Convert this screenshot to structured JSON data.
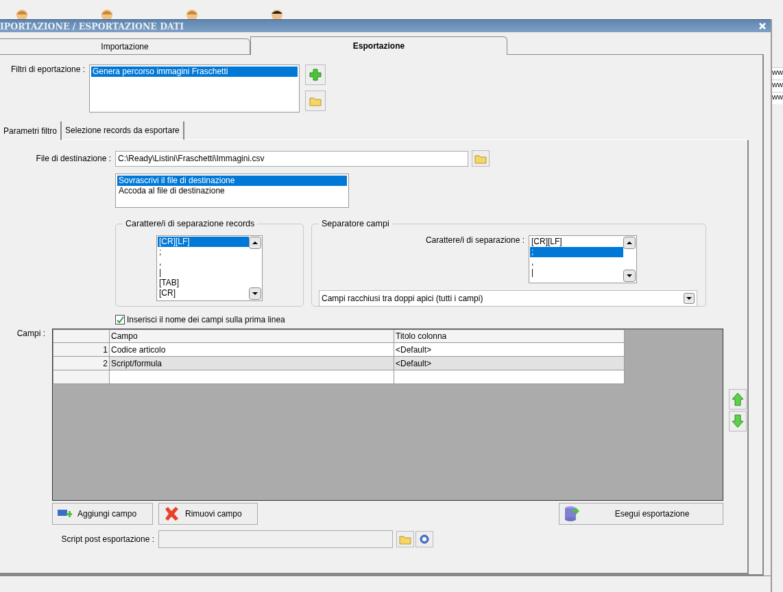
{
  "background": {
    "right_rows": [
      "ww",
      "ww",
      "ww"
    ]
  },
  "window": {
    "title": "IPORTAZIONE / ESPORTAZIONE DATI"
  },
  "tabs": [
    {
      "label": "Importazione",
      "selected": false
    },
    {
      "label": "Esportazione",
      "selected": true
    }
  ],
  "export_filters": {
    "label": "Filtri di eportazione :",
    "items": [
      {
        "label": "Genera percorso immagini Fraschetti",
        "selected": true
      }
    ]
  },
  "subtabs": [
    {
      "label": "Parametri filtro",
      "selected": true
    },
    {
      "label": "Selezione records da esportare",
      "selected": false
    }
  ],
  "destination": {
    "label": "File di destinazione :",
    "value": "C:\\Ready\\Listini\\Fraschetti\\Immagini.csv"
  },
  "write_mode": [
    {
      "label": "Sovrascrivi il file di destinazione",
      "selected": true
    },
    {
      "label": "Accoda al file di destinazione",
      "selected": false
    }
  ],
  "record_separator": {
    "title": "Carattere/i di separazione records",
    "items": [
      {
        "label": "[CR][LF]",
        "selected": true
      },
      {
        "label": ";",
        "selected": false
      },
      {
        "label": ",",
        "selected": false
      },
      {
        "label": "|",
        "selected": false
      },
      {
        "label": "[TAB]",
        "selected": false
      },
      {
        "label": "[CR]",
        "selected": false
      }
    ]
  },
  "field_separator": {
    "title": "Separatore campi",
    "label": "Carattere/i di separazione :",
    "items": [
      {
        "label": "[CR][LF]",
        "selected": false
      },
      {
        "label": ";",
        "selected": true
      },
      {
        "label": ",",
        "selected": false
      },
      {
        "label": "|",
        "selected": false
      }
    ],
    "quoting": "Campi racchiusi tra doppi apici (tutti i campi)"
  },
  "header_checkbox": {
    "label": "Inserisci il nome dei campi sulla prima linea",
    "checked": true
  },
  "fields": {
    "label": "Campi :",
    "columns": [
      "Campo",
      "Titolo colonna"
    ],
    "rows": [
      {
        "number": "1",
        "field": "Codice articolo",
        "title": "<Default>",
        "selected": false
      },
      {
        "number": "2",
        "field": "Script/formula",
        "title": "<Default>",
        "selected": true
      }
    ]
  },
  "buttons": [
    {
      "kind": "add",
      "label": "Aggiungi campo"
    },
    {
      "kind": "remove",
      "label": "Rimuovi campo"
    },
    {
      "kind": "run",
      "label": "Esegui esportazione"
    }
  ],
  "post_script": {
    "label": "Script post esportazione :",
    "disabled": true
  }
}
